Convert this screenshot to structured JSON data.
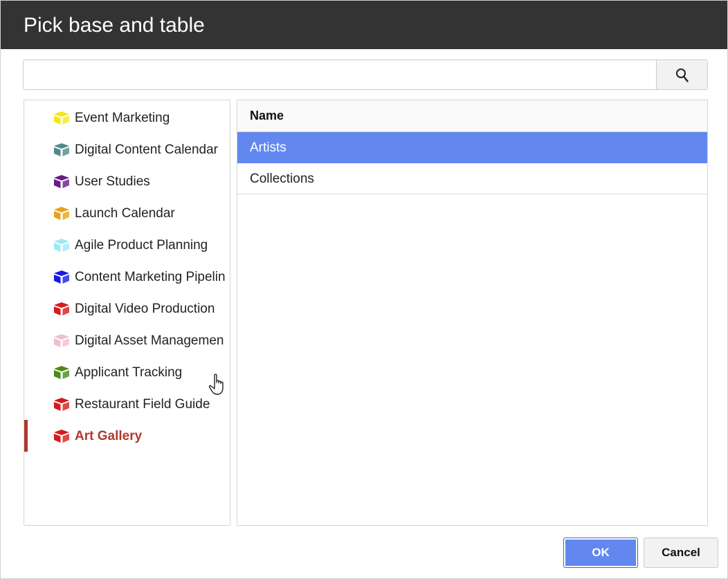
{
  "dialog": {
    "title": "Pick base and table"
  },
  "search": {
    "value": "",
    "placeholder": "",
    "button_icon": "search-icon"
  },
  "bases": [
    {
      "label": "Event Marketing",
      "color": "#f2e81d",
      "selected": false
    },
    {
      "label": "Digital Content Calendar",
      "color": "#4e8a8c",
      "selected": false
    },
    {
      "label": "User Studies",
      "color": "#6a1b8a",
      "selected": false
    },
    {
      "label": "Launch Calendar",
      "color": "#e8a21a",
      "selected": false
    },
    {
      "label": "Agile Product Planning",
      "color": "#9fe8f7",
      "selected": false
    },
    {
      "label": "Content Marketing Pipelin",
      "color": "#1a1ae8",
      "selected": false
    },
    {
      "label": "Digital Video Production",
      "color": "#d41c1c",
      "selected": false
    },
    {
      "label": "Digital Asset Managemen",
      "color": "#f2bdd0",
      "selected": false
    },
    {
      "label": "Applicant Tracking",
      "color": "#4a8a1a",
      "selected": false
    },
    {
      "label": "Restaurant Field Guide",
      "color": "#d41c1c",
      "selected": false
    },
    {
      "label": "Art Gallery",
      "color": "#d41c1c",
      "selected": true
    }
  ],
  "tables": {
    "header": "Name",
    "rows": [
      {
        "label": "Artists",
        "selected": true
      },
      {
        "label": "Collections",
        "selected": false
      }
    ]
  },
  "actions": {
    "ok_label": "OK",
    "cancel_label": "Cancel"
  },
  "colors": {
    "titlebar": "#333333",
    "accent": "#6288f0",
    "selected_base": "#b03a2e"
  }
}
